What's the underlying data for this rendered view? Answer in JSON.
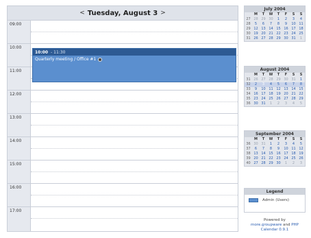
{
  "day_view": {
    "title": "Tuesday, August 3",
    "prev_arrow": "<",
    "next_arrow": ">",
    "hours": [
      "09:00",
      "10:00",
      "11:00",
      "12:00",
      "13:00",
      "14:00",
      "15:00",
      "16:00",
      "17:00"
    ],
    "event": {
      "start": "10:00",
      "end": "- 11:30",
      "title": "Quarterly meeting / Office #1"
    }
  },
  "mini_calendars": [
    {
      "title": "July 2004",
      "weekdays": [
        "",
        "M",
        "T",
        "W",
        "T",
        "F",
        "S",
        "S"
      ],
      "rows": [
        [
          "27",
          "28",
          "29",
          "30",
          "1",
          "2",
          "3",
          "4"
        ],
        [
          "28",
          "5",
          "6",
          "7",
          "8",
          "9",
          "10",
          "11"
        ],
        [
          "29",
          "12",
          "13",
          "14",
          "15",
          "16",
          "17",
          "18"
        ],
        [
          "30",
          "19",
          "20",
          "21",
          "22",
          "23",
          "24",
          "25"
        ],
        [
          "31",
          "26",
          "27",
          "28",
          "29",
          "30",
          "31",
          "1"
        ]
      ]
    },
    {
      "title": "August 2004",
      "weekdays": [
        "",
        "M",
        "T",
        "W",
        "T",
        "F",
        "S",
        "S"
      ],
      "rows": [
        [
          "31",
          "26",
          "27",
          "28",
          "29",
          "30",
          "31",
          "1"
        ],
        [
          "32",
          "2",
          "3",
          "4",
          "5",
          "6",
          "7",
          "8"
        ],
        [
          "33",
          "9",
          "10",
          "11",
          "12",
          "13",
          "14",
          "15"
        ],
        [
          "34",
          "16",
          "17",
          "18",
          "19",
          "20",
          "21",
          "22"
        ],
        [
          "35",
          "23",
          "24",
          "25",
          "26",
          "27",
          "28",
          "29"
        ],
        [
          "36",
          "30",
          "31",
          "1",
          "2",
          "3",
          "4",
          "5"
        ]
      ]
    },
    {
      "title": "September 2004",
      "weekdays": [
        "",
        "M",
        "T",
        "W",
        "T",
        "F",
        "S",
        "S"
      ],
      "rows": [
        [
          "36",
          "30",
          "31",
          "1",
          "2",
          "3",
          "4",
          "5"
        ],
        [
          "37",
          "6",
          "7",
          "8",
          "9",
          "10",
          "11",
          "12"
        ],
        [
          "38",
          "13",
          "14",
          "15",
          "16",
          "17",
          "18",
          "19"
        ],
        [
          "39",
          "20",
          "21",
          "22",
          "23",
          "24",
          "25",
          "26"
        ],
        [
          "40",
          "27",
          "28",
          "29",
          "30",
          "1",
          "2",
          "3"
        ]
      ]
    }
  ],
  "legend": {
    "title": "Legend",
    "item_label": "Admin (Users)"
  },
  "powered": {
    "line1": "Powered by",
    "link1": "more.groupware",
    "and": " and ",
    "link2": "PHP Calendar 0.9.1"
  }
}
